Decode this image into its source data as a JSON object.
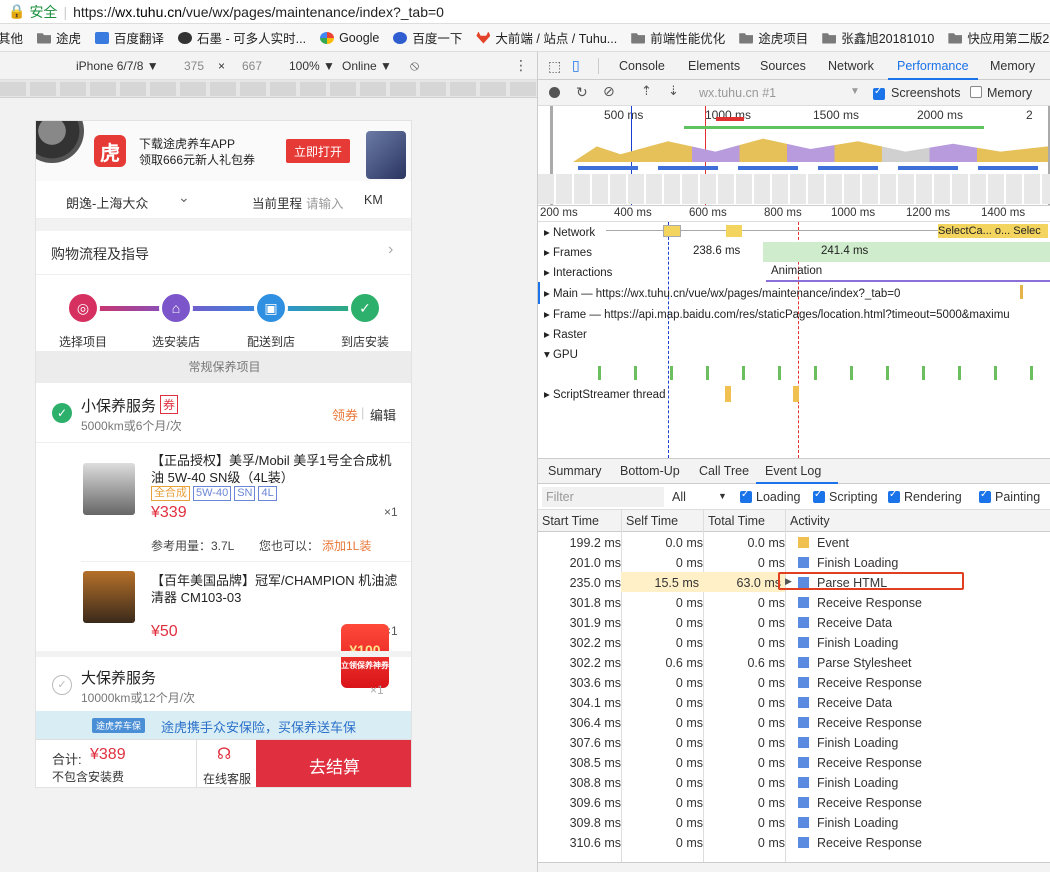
{
  "browser": {
    "secure_label": "安全",
    "url_prefix": "https://",
    "url_host": "wx.tuhu.cn",
    "url_path": "/vue/wx/pages/maintenance/index?_tab=0",
    "bookmarks": [
      "其他",
      "途虎",
      "百度翻译",
      "石墨 - 可多人实时...",
      "Google",
      "百度一下",
      "大前端 / 站点 / Tuhu...",
      "前端性能优化",
      "途虎项目",
      "张鑫旭20181010",
      "快应用第二版2"
    ]
  },
  "device_toolbar": {
    "device": "iPhone 6/7/8 ▼",
    "width": "375",
    "times": "×",
    "height": "667",
    "zoom": "100% ▼",
    "network": "Online ▼"
  },
  "page": {
    "banner_line1": "下载途虎养车APP",
    "banner_line2": "领取666元新人礼包券",
    "banner_button": "立即打开",
    "brand_logo": "虎",
    "car_model": "朗逸-上海大众",
    "mileage_label": "当前里程",
    "mileage_placeholder": "请输入",
    "mileage_unit": "KM",
    "guide_title": "购物流程及指导",
    "steps": [
      "选择项目",
      "选安装店",
      "配送到店",
      "到店安装"
    ],
    "section_header": "常规保养项目",
    "service1_title": "小保养服务",
    "service1_coupon_badge": "券",
    "service1_sub": "5000km或6个月/次",
    "service1_coupon": "领券",
    "service1_edit": "编辑",
    "product1_name": "【正品授权】美孚/Mobil 美孚1号全合成机油 5W-40 SN级（4L装）",
    "product1_tags": [
      "全合成",
      "5W-40",
      "SN",
      "4L"
    ],
    "product1_price": "¥339",
    "product1_qty": "×1",
    "product1_ref": "参考用量：3.7L",
    "product1_also": "您也可以：",
    "product1_add": "添加1L装",
    "product2_name": "【百年美国品牌】冠军/CHAMPION 机油滤清器 CM103-03",
    "product2_price": "¥50",
    "product2_qty": "×1",
    "redpacket_amount": "¥100",
    "redpacket_sub": "立领保养神券",
    "service2_title": "大保养服务",
    "service2_sub": "10000km或12个月/次",
    "service2_qty": "×1",
    "insurance_logo": "途虎养车保",
    "insurance_text": "途虎携手众安保险，买保养送车保",
    "total_label": "合计:",
    "total_value": "¥389",
    "total_note": "不包含安装费",
    "service_label": "在线客服",
    "pay_button": "去结算"
  },
  "devtools": {
    "tabs": [
      "Console",
      "Elements",
      "Sources",
      "Network",
      "Performance",
      "Memory"
    ],
    "active_tab": "Performance",
    "profile_select": "wx.tuhu.cn #1",
    "screenshots_label": "Screenshots",
    "memory_label": "Memory",
    "overview_ticks": [
      "500 ms",
      "1000 ms",
      "1500 ms",
      "2000 ms",
      "2"
    ],
    "axis_ticks": [
      "200 ms",
      "400 ms",
      "600 ms",
      "800 ms",
      "1000 ms",
      "1200 ms",
      "1400 ms"
    ],
    "tracks": {
      "network": "Network",
      "network_item1": "SelectCa...",
      "network_item2": "o...",
      "network_item3": "Selec",
      "frames": "Frames",
      "frame1": "238.6 ms",
      "frame2": "241.4 ms",
      "interactions": "Interactions",
      "animation": "Animation",
      "main": "Main — https://wx.tuhu.cn/vue/wx/pages/maintenance/index?_tab=0",
      "frame": "Frame — https://api.map.baidu.com/res/staticPages/location.html?timeout=5000&maximu",
      "raster": "Raster",
      "gpu": "GPU",
      "scriptstreamer": "ScriptStreamer thread"
    },
    "bottom_tabs": [
      "Summary",
      "Bottom-Up",
      "Call Tree",
      "Event Log"
    ],
    "active_bottom_tab": "Event Log",
    "filter_placeholder": "Filter",
    "filter_select": "All",
    "filter_checks": [
      "Loading",
      "Scripting",
      "Rendering",
      "Painting"
    ],
    "columns": [
      "Start Time",
      "Self Time",
      "Total Time",
      "Activity"
    ],
    "rows": [
      {
        "start": "199.2 ms",
        "self": "0.0 ms",
        "total": "0.0 ms",
        "activity": "Event",
        "color": "#f0c050"
      },
      {
        "start": "201.0 ms",
        "self": "0 ms",
        "total": "0 ms",
        "activity": "Finish Loading",
        "color": "#5b8be0"
      },
      {
        "start": "235.0 ms",
        "self": "15.5 ms",
        "total": "63.0 ms",
        "activity": "Parse HTML",
        "color": "#5b8be0"
      },
      {
        "start": "301.8 ms",
        "self": "0 ms",
        "total": "0 ms",
        "activity": "Receive Response",
        "color": "#5b8be0"
      },
      {
        "start": "301.9 ms",
        "self": "0 ms",
        "total": "0 ms",
        "activity": "Receive Data",
        "color": "#5b8be0"
      },
      {
        "start": "302.2 ms",
        "self": "0 ms",
        "total": "0 ms",
        "activity": "Finish Loading",
        "color": "#5b8be0"
      },
      {
        "start": "302.2 ms",
        "self": "0.6 ms",
        "total": "0.6 ms",
        "activity": "Parse Stylesheet",
        "color": "#5b8be0"
      },
      {
        "start": "303.6 ms",
        "self": "0 ms",
        "total": "0 ms",
        "activity": "Receive Response",
        "color": "#5b8be0"
      },
      {
        "start": "304.1 ms",
        "self": "0 ms",
        "total": "0 ms",
        "activity": "Receive Data",
        "color": "#5b8be0"
      },
      {
        "start": "306.4 ms",
        "self": "0 ms",
        "total": "0 ms",
        "activity": "Receive Response",
        "color": "#5b8be0"
      },
      {
        "start": "307.6 ms",
        "self": "0 ms",
        "total": "0 ms",
        "activity": "Finish Loading",
        "color": "#5b8be0"
      },
      {
        "start": "308.5 ms",
        "self": "0 ms",
        "total": "0 ms",
        "activity": "Receive Response",
        "color": "#5b8be0"
      },
      {
        "start": "308.8 ms",
        "self": "0 ms",
        "total": "0 ms",
        "activity": "Finish Loading",
        "color": "#5b8be0"
      },
      {
        "start": "309.6 ms",
        "self": "0 ms",
        "total": "0 ms",
        "activity": "Receive Response",
        "color": "#5b8be0"
      },
      {
        "start": "309.8 ms",
        "self": "0 ms",
        "total": "0 ms",
        "activity": "Finish Loading",
        "color": "#5b8be0"
      },
      {
        "start": "310.6 ms",
        "self": "0 ms",
        "total": "0 ms",
        "activity": "Receive Response",
        "color": "#5b8be0"
      }
    ]
  }
}
